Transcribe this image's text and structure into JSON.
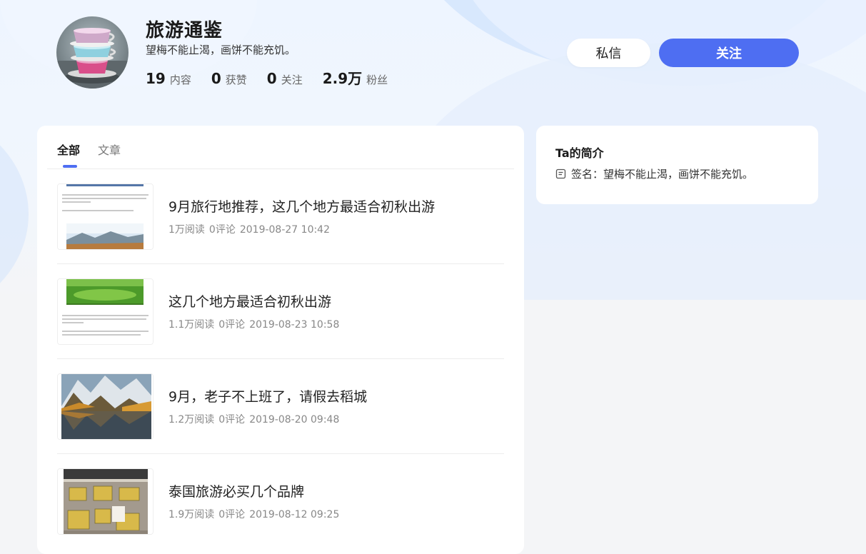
{
  "profile": {
    "name": "旅游通鉴",
    "motto": "望梅不能止渴，画饼不能充饥。",
    "stats": [
      {
        "value": "19",
        "label": "内容"
      },
      {
        "value": "0",
        "label": "获赞"
      },
      {
        "value": "0",
        "label": "关注"
      },
      {
        "value": "2.9万",
        "label": "粉丝"
      }
    ],
    "avatar_icon": "teacup-stack-avatar"
  },
  "actions": {
    "message_label": "私信",
    "follow_label": "关注"
  },
  "tabs": [
    {
      "label": "全部",
      "active": true
    },
    {
      "label": "文章",
      "active": false
    }
  ],
  "articles": [
    {
      "title": "9月旅行地推荐，这几个地方最适合初秋出游",
      "reads": "1万阅读",
      "comments": "0评论",
      "date": "2019-08-27 10:42",
      "thumb": "text-with-mountain-lake-photo"
    },
    {
      "title": "这几个地方最适合初秋出游",
      "reads": "1.1万阅读",
      "comments": "0评论",
      "date": "2019-08-23 10:58",
      "thumb": "green-meadow-photo-with-text"
    },
    {
      "title": "9月，老子不上班了，请假去稻城",
      "reads": "1.2万阅读",
      "comments": "0评论",
      "date": "2019-08-20 09:48",
      "thumb": "autumn-mountain-lake-photo"
    },
    {
      "title": "泰国旅游必买几个品牌",
      "reads": "1.9万阅读",
      "comments": "0评论",
      "date": "2019-08-12 09:25",
      "thumb": "shop-window-bags-photo"
    }
  ],
  "about": {
    "title": "Ta的简介",
    "signature_label": "签名：",
    "signature": "望梅不能止渴，画饼不能充饥。",
    "icon": "document-icon"
  },
  "colors": {
    "accent": "#4e6ef2",
    "page_bg": "#f4f5f7",
    "card_bg": "#ffffff"
  }
}
